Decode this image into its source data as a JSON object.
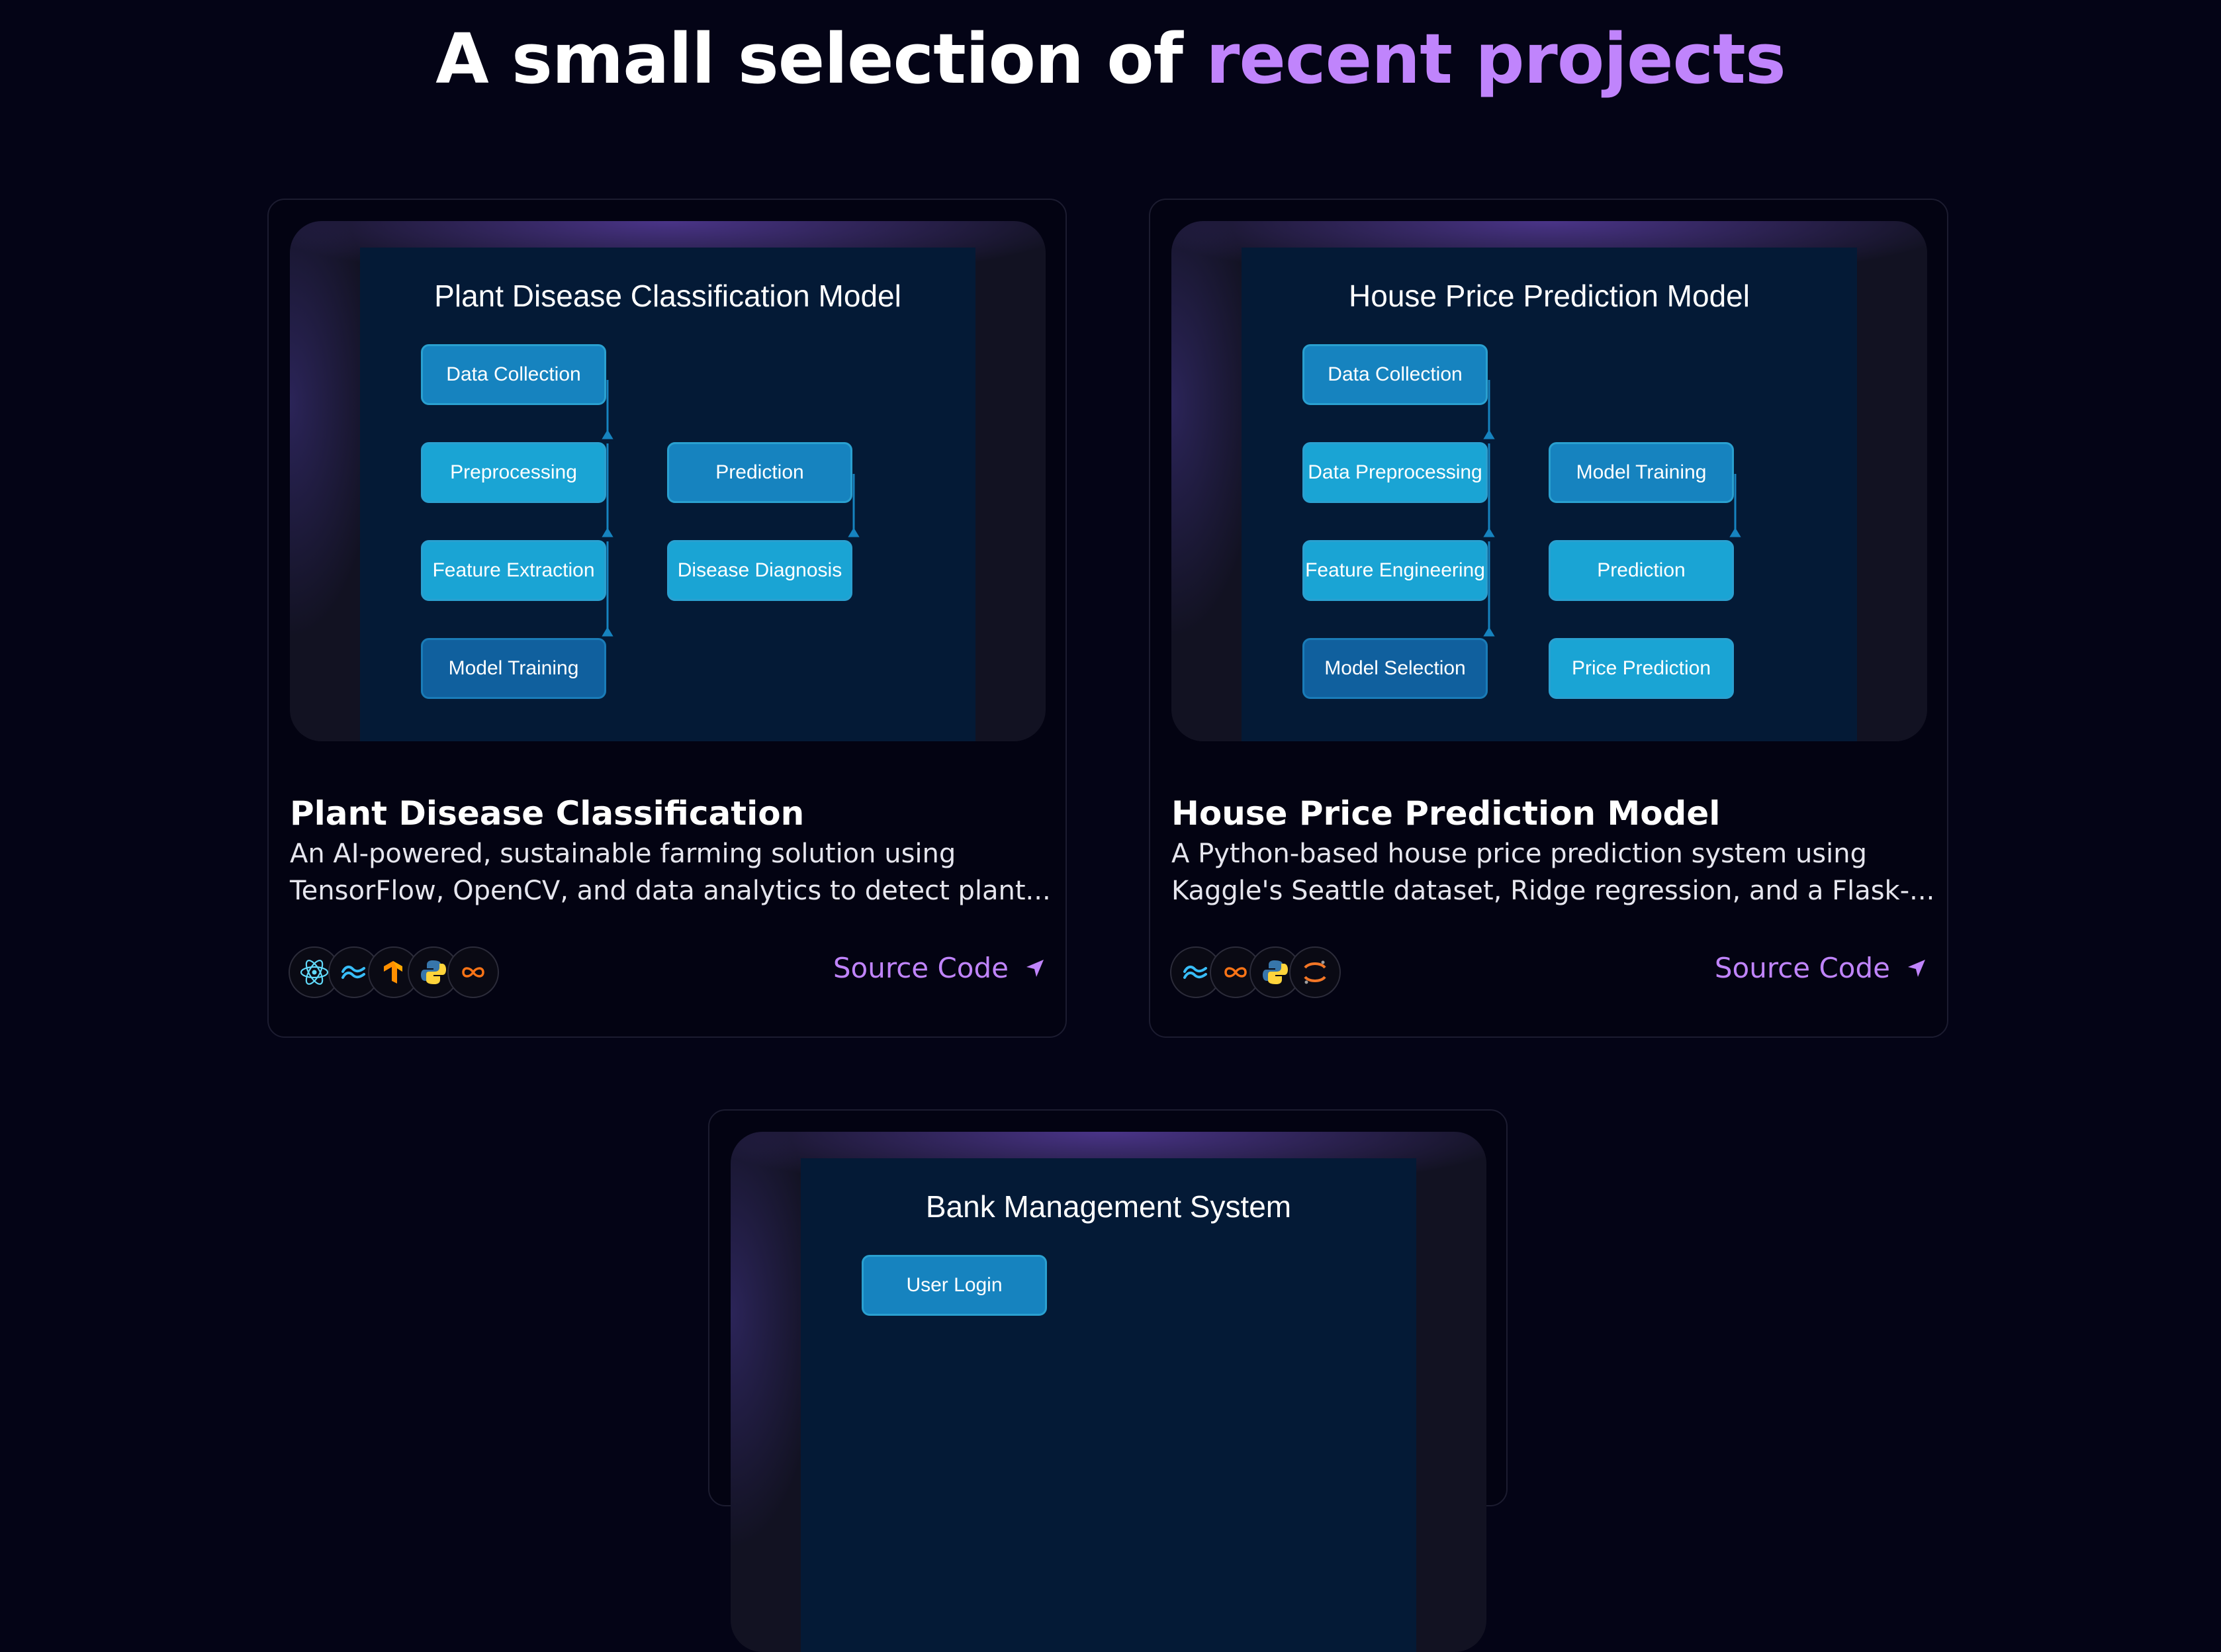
{
  "heading": {
    "text": "A small selection of ",
    "accent": "recent projects"
  },
  "colors": {
    "background": "#040416",
    "accent": "#c084fc",
    "node_mid": "#1683bf",
    "node_light": "#1aa4d4",
    "node_dark": "#10609e"
  },
  "projects": [
    {
      "diagram_title": "Plant Disease Classification Model",
      "nodes": [
        "Data Collection",
        "Preprocessing",
        "Feature Extraction",
        "Model Training",
        "Prediction",
        "Disease Diagnosis"
      ],
      "title": "Plant Disease Classification",
      "description": "An AI-powered, sustainable farming solution using\nTensorFlow, OpenCV, and data analytics to detect plant...",
      "tech_icons": [
        "react-icon",
        "tailwind-icon",
        "tensorflow-icon",
        "python-icon",
        "infinity-icon"
      ],
      "link_label": "Source Code"
    },
    {
      "diagram_title": "House Price Prediction Model",
      "nodes": [
        "Data Collection",
        "Data Preprocessing",
        "Feature Engineering",
        "Model Selection",
        "Model Training",
        "Prediction",
        "Price Prediction"
      ],
      "title": "House Price Prediction Model",
      "description": "A Python-based house price prediction system using\nKaggle's Seattle dataset, Ridge regression, and a Flask-...",
      "tech_icons": [
        "tailwind-icon",
        "infinity-icon",
        "python-icon",
        "jupyter-icon"
      ],
      "link_label": "Source Code"
    },
    {
      "diagram_title": "Bank Management System",
      "nodes": [
        "User Login"
      ]
    }
  ]
}
